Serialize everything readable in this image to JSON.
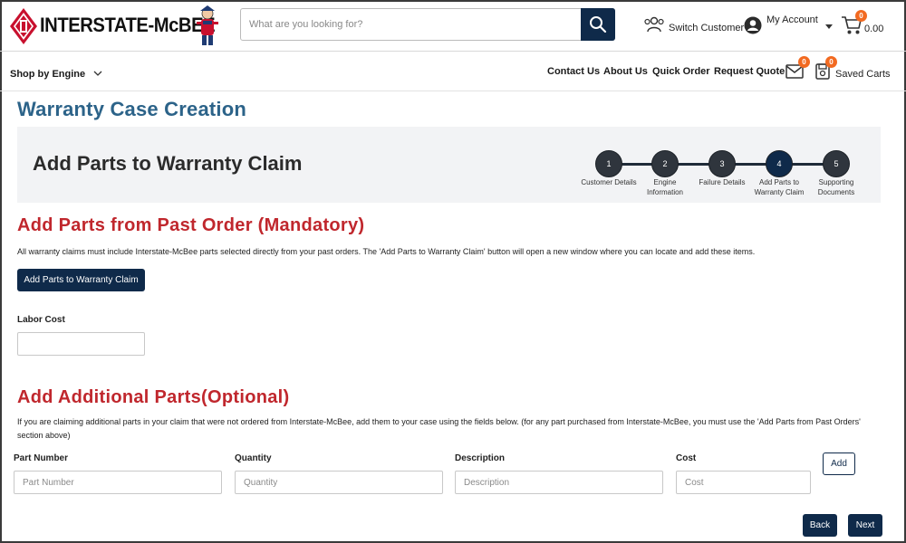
{
  "header": {
    "brand": "INTERSTATE-McBEE",
    "search_placeholder": "What are you looking for?",
    "switch_customer": "Switch Customer",
    "my_account": "My Account",
    "cart_count": "0",
    "cart_total": "0.00"
  },
  "nav": {
    "shop_by_engine": "Shop by Engine",
    "links": [
      "Contact Us",
      "About Us",
      "Quick Order",
      "Request Quote"
    ],
    "messages_count": "0",
    "saved_carts_count": "0",
    "saved_carts": "Saved Carts"
  },
  "page": {
    "title": "Warranty Case Creation",
    "panel_title": "Add Parts to Warranty Claim"
  },
  "stepper": {
    "steps": [
      {
        "number": "1",
        "label_1": "Customer Details",
        "label_2": ""
      },
      {
        "number": "2",
        "label_1": "Engine",
        "label_2": "Information"
      },
      {
        "number": "3",
        "label_1": "Failure Details",
        "label_2": ""
      },
      {
        "number": "4",
        "label_1": "Add Parts to",
        "label_2": "Warranty Claim"
      },
      {
        "number": "5",
        "label_1": "Supporting",
        "label_2": "Documents"
      }
    ],
    "active_step": 4
  },
  "past_order": {
    "title": "Add Parts from Past Order (Mandatory)",
    "description": "All warranty claims must include Interstate-McBee parts selected directly from your past orders. The 'Add Parts to Warranty Claim' button will open a new window where you can locate and add these items.",
    "button": "Add Parts to Warranty Claim",
    "labor_cost_label": "Labor Cost",
    "labor_cost_value": ""
  },
  "additional": {
    "title": "Add Additional Parts(Optional)",
    "description": "If you are claiming additional parts in your claim that were not ordered from Interstate-McBee, add them to your case using the fields below. (for any part purchased from Interstate-McBee, you must use the 'Add Parts from Past Orders' section above)",
    "part_number_label": "Part Number",
    "part_number_placeholder": "Part Number",
    "quantity_label": "Quantity",
    "quantity_placeholder": "Quantity",
    "description_label": "Description",
    "description_placeholder": "Description",
    "cost_label": "Cost",
    "cost_placeholder": "Cost",
    "add_button": "Add"
  },
  "footer": {
    "back_button": "Back",
    "next_button": "Next"
  },
  "colors": {
    "accent_dark": "#0f2a4a",
    "title_blue": "#2c6389",
    "section_red": "#c0272d",
    "badge_orange": "#f26a21"
  }
}
